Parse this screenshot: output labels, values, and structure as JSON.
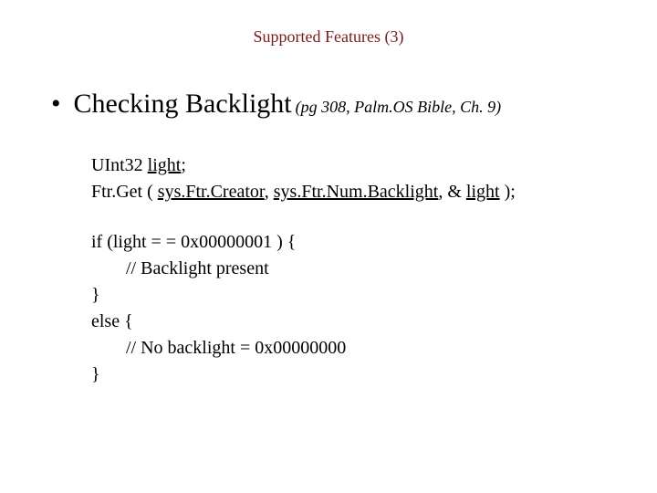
{
  "title": "Supported Features (3)",
  "headline": "Checking Backlight",
  "citation": "(pg 308, Palm.OS Bible, Ch. 9)",
  "code": {
    "l1a": "UInt32 ",
    "l1b": "light",
    "l1c": ";",
    "l2a": "Ftr.Get ( ",
    "l2b": "sys.Ftr.Creator",
    "l2c": ", ",
    "l2d": "sys.Ftr.Num.Backlight",
    "l2e": ", & ",
    "l2f": "light",
    "l2g": " );",
    "l3": "if (light = = 0x00000001 ) {",
    "l4": "// Backlight present",
    "l5": "}",
    "l6": "else {",
    "l7": "// No backlight = 0x00000000",
    "l8": "}"
  }
}
